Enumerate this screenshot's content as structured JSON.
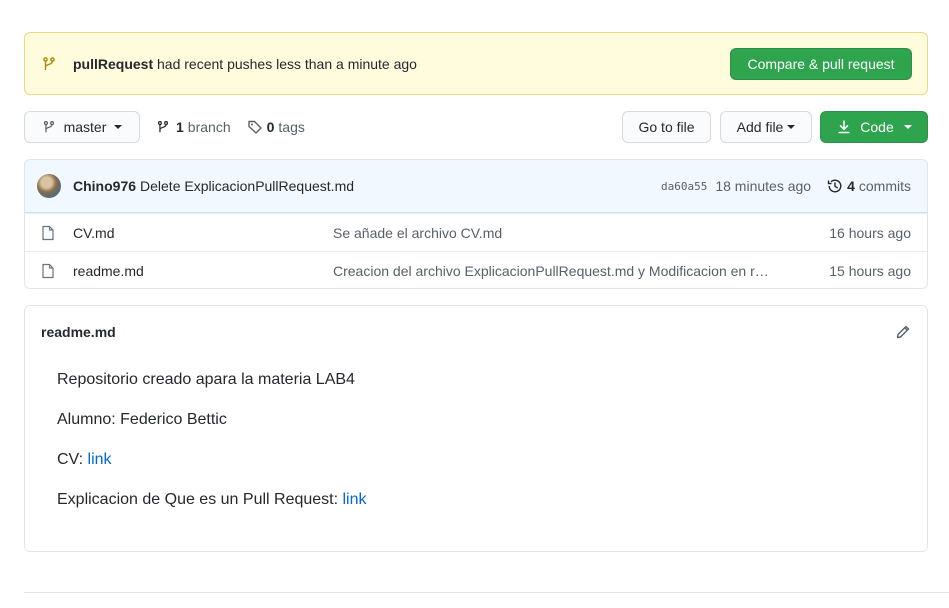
{
  "banner": {
    "branch_name": "pullRequest",
    "message": "had recent pushes less than a minute ago",
    "compare_button": "Compare & pull request"
  },
  "toolbar": {
    "branch_selected": "master",
    "branch_count": "1",
    "branch_label": "branch",
    "tag_count": "0",
    "tag_label": "tags",
    "goto_file": "Go to file",
    "add_file": "Add file",
    "code": "Code"
  },
  "latest_commit": {
    "author": "Chino976",
    "message": "Delete ExplicacionPullRequest.md",
    "sha": "da60a55",
    "time": "18 minutes ago",
    "commit_count": "4",
    "commits_label": "commits"
  },
  "files": [
    {
      "name": "CV.md",
      "commit": "Se añade el archivo CV.md",
      "age": "16 hours ago"
    },
    {
      "name": "readme.md",
      "commit": "Creacion del archivo ExplicacionPullRequest.md y Modificacion en readme.md",
      "age": "15 hours ago"
    }
  ],
  "readme": {
    "title": "readme.md",
    "line1": "Repositorio creado apara la materia LAB4",
    "line2": "Alumno: Federico Bettic",
    "line3_prefix": "CV: ",
    "line3_link": "link",
    "line4_prefix": "Explicacion de Que es un Pull Request: ",
    "line4_link": "link"
  },
  "colors": {
    "green": "#2ea44f",
    "banner_bg": "#fffbdd",
    "commit_bg": "#f1f8ff",
    "link": "#0366d6"
  },
  "icons": [
    "git-branch-icon",
    "tag-icon",
    "download-icon",
    "history-icon",
    "file-icon",
    "pencil-icon"
  ]
}
